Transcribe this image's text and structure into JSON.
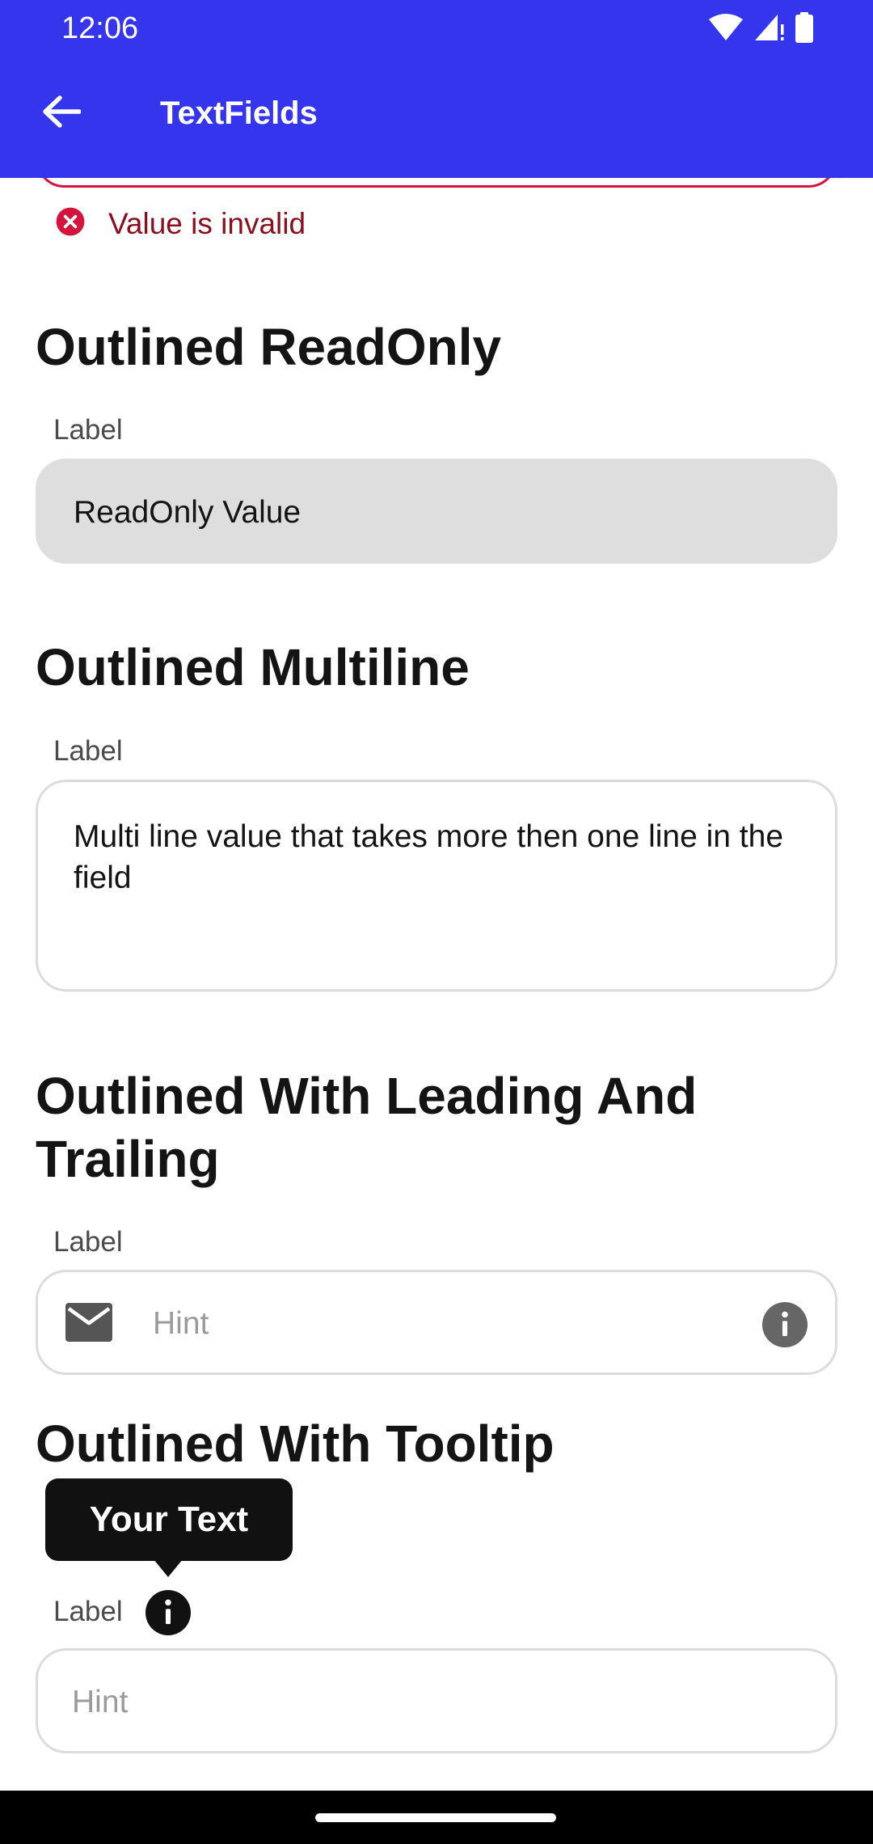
{
  "status_bar": {
    "time": "12:06"
  },
  "app_bar": {
    "title": "TextFields"
  },
  "invalid_section": {
    "error_text": "Value is invalid"
  },
  "readonly_section": {
    "title": "Outlined ReadOnly",
    "label": "Label",
    "value": "ReadOnly Value"
  },
  "multiline_section": {
    "title": "Outlined Multiline",
    "label": "Label",
    "value": "Multi line value that takes more then one line in the field"
  },
  "leading_trailing_section": {
    "title_line1": "Outlined With Leading And",
    "title_line2": "Trailing",
    "label": "Label",
    "hint": "Hint",
    "leading_icon": "mail-icon",
    "trailing_icon": "info-icon"
  },
  "tooltip_section": {
    "title": "Outlined With Tooltip",
    "tooltip_text": "Your Text",
    "label": "Label",
    "label_icon": "info-icon",
    "hint": "Hint"
  },
  "colors": {
    "app_bar": "#3535ee",
    "error": "#d4143c",
    "readonly_fill": "#dedede",
    "border": "#dcdcdc"
  }
}
